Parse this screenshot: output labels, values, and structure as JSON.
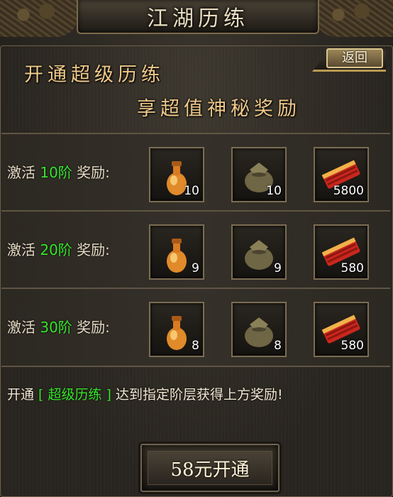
{
  "title": "江湖历练",
  "headline": {
    "line1": "开通超级历练",
    "line2": "享超值神秘奖励"
  },
  "back_label": "返回",
  "reward_label": {
    "prefix": "激活 ",
    "suffix": " 奖励:"
  },
  "tiers": [
    {
      "level": "10阶",
      "rewards": [
        {
          "icon": "potion-flask-icon",
          "qty": "10"
        },
        {
          "icon": "item-pouch-icon",
          "qty": "10"
        },
        {
          "icon": "red-ingot-bundle-icon",
          "qty": "5800"
        }
      ]
    },
    {
      "level": "20阶",
      "rewards": [
        {
          "icon": "potion-flask-icon",
          "qty": "9"
        },
        {
          "icon": "item-pouch-icon",
          "qty": "9"
        },
        {
          "icon": "red-ingot-bundle-icon",
          "qty": "580"
        }
      ]
    },
    {
      "level": "30阶",
      "rewards": [
        {
          "icon": "potion-flask-icon",
          "qty": "8"
        },
        {
          "icon": "item-pouch-icon",
          "qty": "8"
        },
        {
          "icon": "red-ingot-bundle-icon",
          "qty": "580"
        }
      ]
    }
  ],
  "notice": {
    "prefix": "开通",
    "highlight": " [ 超级历练 ] ",
    "suffix": "达到指定阶层获得上方奖励!"
  },
  "open_button_label": "58元开通",
  "colors": {
    "level_green": "#35e62a",
    "headline_gold": "#f0c98a"
  }
}
